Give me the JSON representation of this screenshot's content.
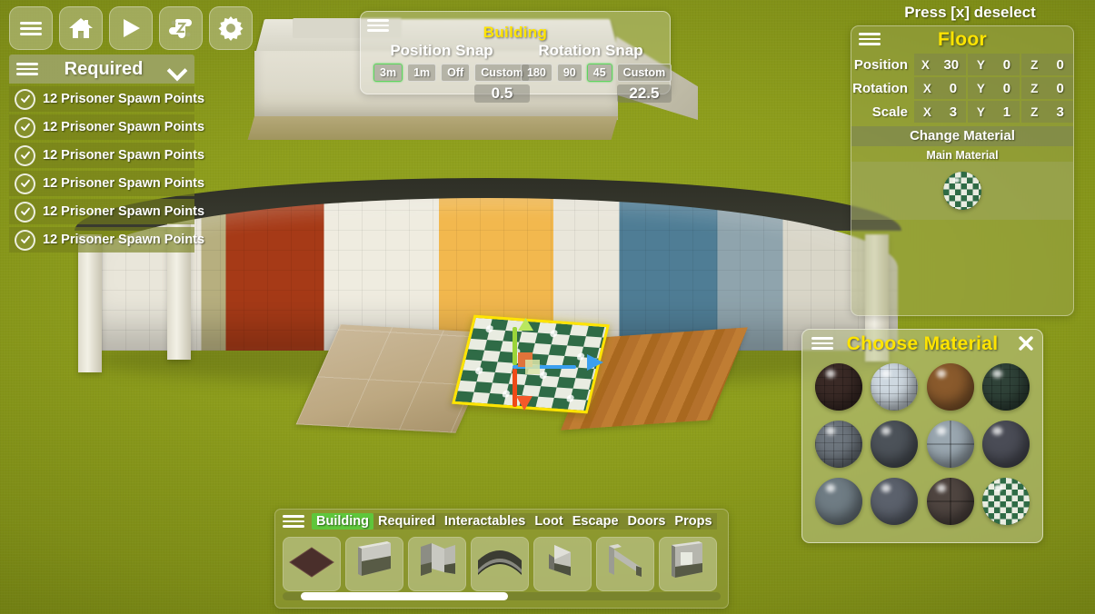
{
  "toolbar": {
    "buttons": [
      {
        "name": "menu-button",
        "icon": "hamburger-icon"
      },
      {
        "name": "home-button",
        "icon": "home-icon"
      },
      {
        "name": "play-button",
        "icon": "play-icon"
      },
      {
        "name": "quests-button",
        "icon": "scroll-icon"
      },
      {
        "name": "settings-button",
        "icon": "gear-icon"
      }
    ]
  },
  "required_panel": {
    "title": "Required",
    "menu_icon": "hamburger-icon",
    "collapse_icon": "chevron-down-icon",
    "rows": [
      {
        "label": "12 Prisoner Spawn Points",
        "status_icon": "check-circle-icon"
      },
      {
        "label": "12 Prisoner Spawn Points",
        "status_icon": "check-circle-icon"
      },
      {
        "label": "12 Prisoner Spawn Points",
        "status_icon": "check-circle-icon"
      },
      {
        "label": "12 Prisoner Spawn Points",
        "status_icon": "check-circle-icon"
      },
      {
        "label": "12 Prisoner Spawn Points",
        "status_icon": "check-circle-icon"
      },
      {
        "label": "12 Prisoner Spawn Points",
        "status_icon": "check-circle-icon"
      }
    ]
  },
  "building_panel": {
    "title": "Building",
    "menu_icon": "hamburger-icon",
    "position_snap": {
      "label": "Position Snap",
      "options": [
        "3m",
        "1m",
        "Off",
        "Custom"
      ],
      "selected": "3m",
      "custom_value": "0.5"
    },
    "rotation_snap": {
      "label": "Rotation Snap",
      "options": [
        "180",
        "90",
        "45",
        "Custom"
      ],
      "selected": "45",
      "custom_value": "22.5"
    }
  },
  "inspector": {
    "hint": "Press [x] deselect",
    "title": "Floor",
    "menu_icon": "hamburger-icon",
    "transform_rows": [
      {
        "name": "Position",
        "axes": [
          "X",
          "Y",
          "Z"
        ],
        "values": [
          "30",
          "0",
          "0"
        ]
      },
      {
        "name": "Rotation",
        "axes": [
          "X",
          "Y",
          "Z"
        ],
        "values": [
          "0",
          "0",
          "0"
        ]
      },
      {
        "name": "Scale",
        "axes": [
          "X",
          "Y",
          "Z"
        ],
        "values": [
          "3",
          "1",
          "3"
        ]
      }
    ],
    "change_material_label": "Change Material",
    "main_material_label": "Main Material",
    "main_material_swatch": "green-white-checker-sphere"
  },
  "material_picker": {
    "title": "Choose Material",
    "menu_icon": "hamburger-icon",
    "close_icon": "close-icon",
    "materials": [
      {
        "name": "dark-brown-tile",
        "color": "#3a2a26",
        "style": "grid"
      },
      {
        "name": "white-tile",
        "color": "#ced8e0",
        "style": "grid"
      },
      {
        "name": "brown-wood",
        "color": "#8a5a2c",
        "style": "plain"
      },
      {
        "name": "dark-green-tile",
        "color": "#2f4238",
        "style": "grid"
      },
      {
        "name": "grey-brick",
        "color": "#6d757d",
        "style": "grid"
      },
      {
        "name": "dark-speckled-stone",
        "color": "#4c5259",
        "style": "plain"
      },
      {
        "name": "light-grey-concrete",
        "color": "#9aa7b0",
        "style": "seam"
      },
      {
        "name": "charcoal-rock",
        "color": "#4a4c56",
        "style": "plain"
      },
      {
        "name": "blue-grey-smooth",
        "color": "#6f7c84",
        "style": "plain"
      },
      {
        "name": "slate-grey",
        "color": "#5b616c",
        "style": "plain"
      },
      {
        "name": "dark-brown-stone",
        "color": "#4f4540",
        "style": "seam"
      },
      {
        "name": "green-white-checker",
        "color": "#2f6b46",
        "style": "checker"
      }
    ]
  },
  "bottom_bar": {
    "menu_icon": "hamburger-icon",
    "tabs": [
      {
        "label": "Building",
        "active": true
      },
      {
        "label": "Required",
        "active": false
      },
      {
        "label": "Interactables",
        "active": false
      },
      {
        "label": "Loot",
        "active": false
      },
      {
        "label": "Escape",
        "active": false
      },
      {
        "label": "Doors",
        "active": false
      },
      {
        "label": "Props",
        "active": false
      }
    ],
    "pieces": [
      {
        "name": "floor-piece"
      },
      {
        "name": "straight-wall-piece"
      },
      {
        "name": "corner-wall-piece"
      },
      {
        "name": "curved-wall-piece"
      },
      {
        "name": "angled-wall-piece"
      },
      {
        "name": "railing-ramp-piece"
      },
      {
        "name": "window-wall-piece"
      }
    ]
  },
  "colors": {
    "accent_yellow": "#ffe400",
    "selected_green": "#5fc63b",
    "snap_select_border": "#5fd45f",
    "ground": "#8d9b1b"
  }
}
